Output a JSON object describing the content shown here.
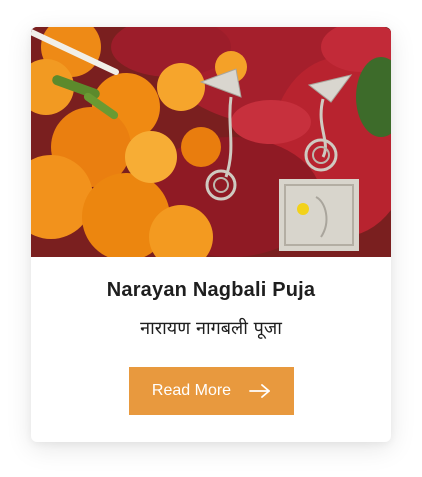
{
  "card": {
    "title": "Narayan Nagbali Puja",
    "subtitle": "नारायण नागबली पूजा",
    "button_label": "Read More",
    "button_icon": "arrow-right-icon",
    "image_icon": "puja-offering-image"
  },
  "colors": {
    "accent": "#e8993e",
    "title_text": "#1e1e1e",
    "button_text": "#ffffff",
    "card_background": "#ffffff"
  }
}
